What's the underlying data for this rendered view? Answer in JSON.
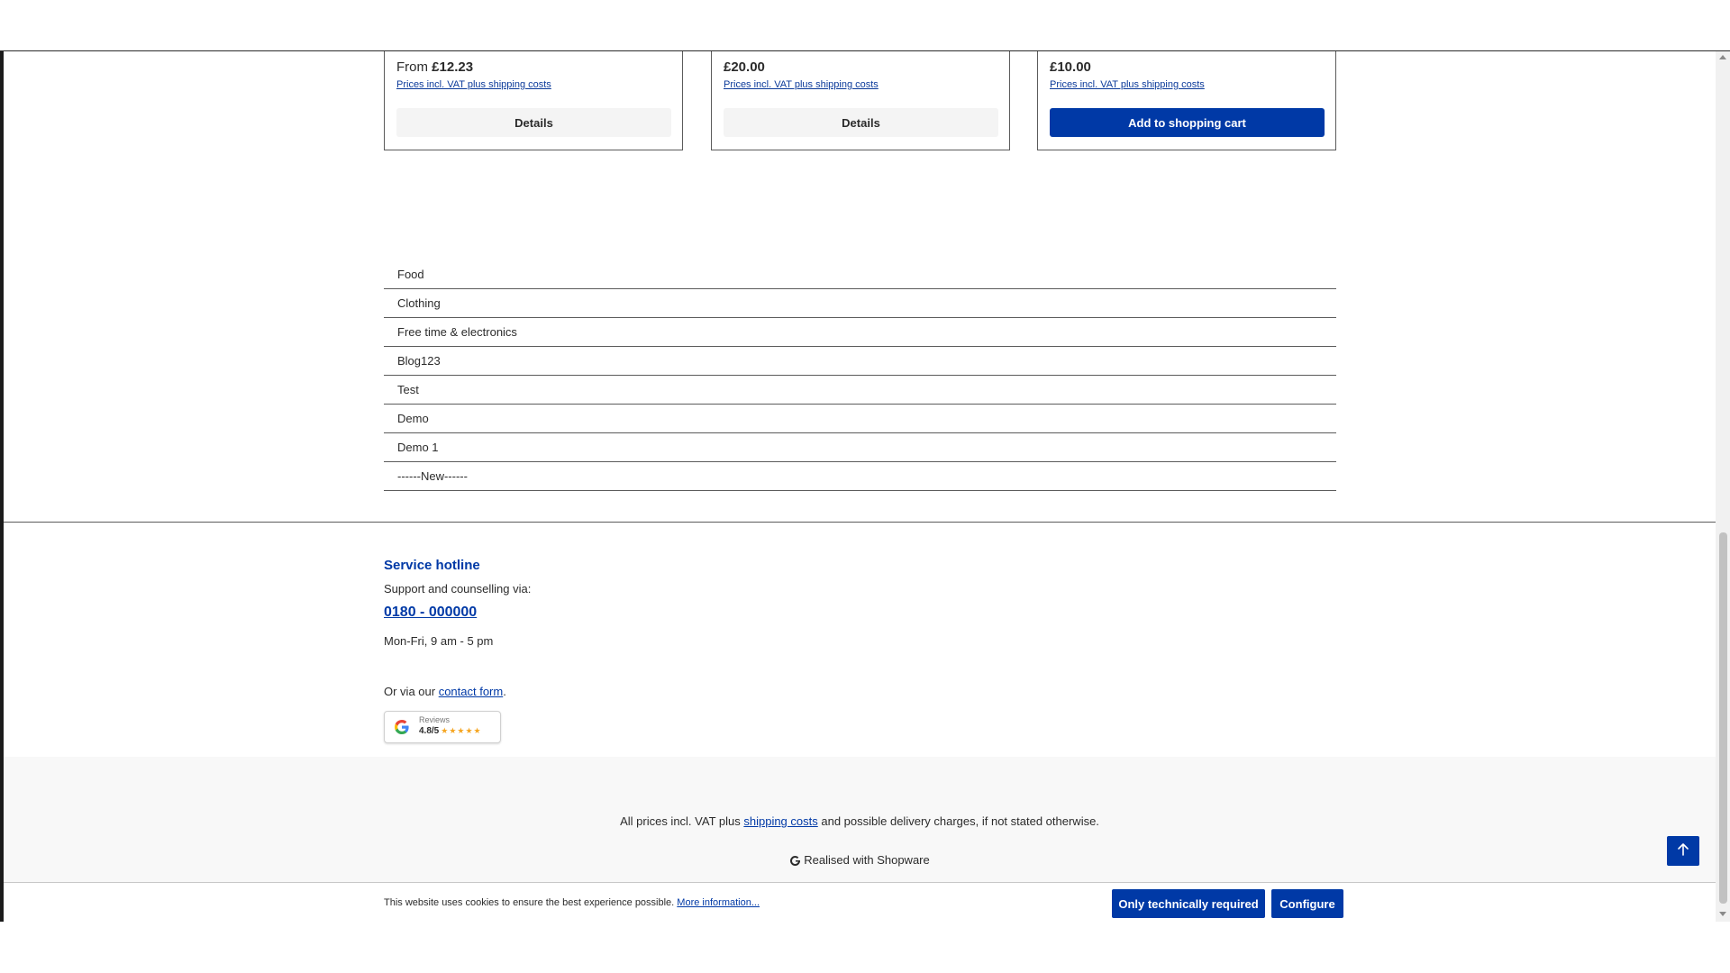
{
  "products": [
    {
      "price_prefix": "From ",
      "price": "£12.23",
      "vat_link": "Prices incl. VAT plus shipping costs",
      "button": "Details"
    },
    {
      "price_prefix": "",
      "price": "£20.00",
      "vat_link": "Prices incl. VAT plus shipping costs",
      "button": "Details"
    },
    {
      "price_prefix": "",
      "price": "£10.00",
      "vat_link": "Prices incl. VAT plus shipping costs",
      "button": "Add to shopping cart"
    }
  ],
  "categories": [
    "Food",
    "Clothing",
    "Free time & electronics",
    "Blog123",
    "Test",
    "Demo",
    "Demo 1",
    "------New------"
  ],
  "service": {
    "title": "Service hotline",
    "subtitle": "Support and counselling via:",
    "phone": "0180 - 000000",
    "hours": "Mon-Fri, 9 am - 5 pm",
    "contact_prefix": "Or via our ",
    "contact_link": "contact form",
    "contact_suffix": "."
  },
  "reviews": {
    "label": "Reviews",
    "score": "4.8/5",
    "stars": "★★★★★"
  },
  "footer": {
    "vat_prefix": "All prices incl. VAT plus ",
    "vat_link": "shipping costs",
    "vat_suffix": " and possible delivery charges, if not stated otherwise.",
    "realised": "Realised with Shopware"
  },
  "cookie": {
    "text": "This website uses cookies to ensure the best experience possible. ",
    "more_link": "More information...",
    "btn_required": "Only technically required",
    "btn_configure": "Configure"
  },
  "colors": {
    "brand": "#0039a6",
    "text": "#2b2b2b",
    "border": "#5b5b5b",
    "footer_bg": "#f8f8f8"
  }
}
